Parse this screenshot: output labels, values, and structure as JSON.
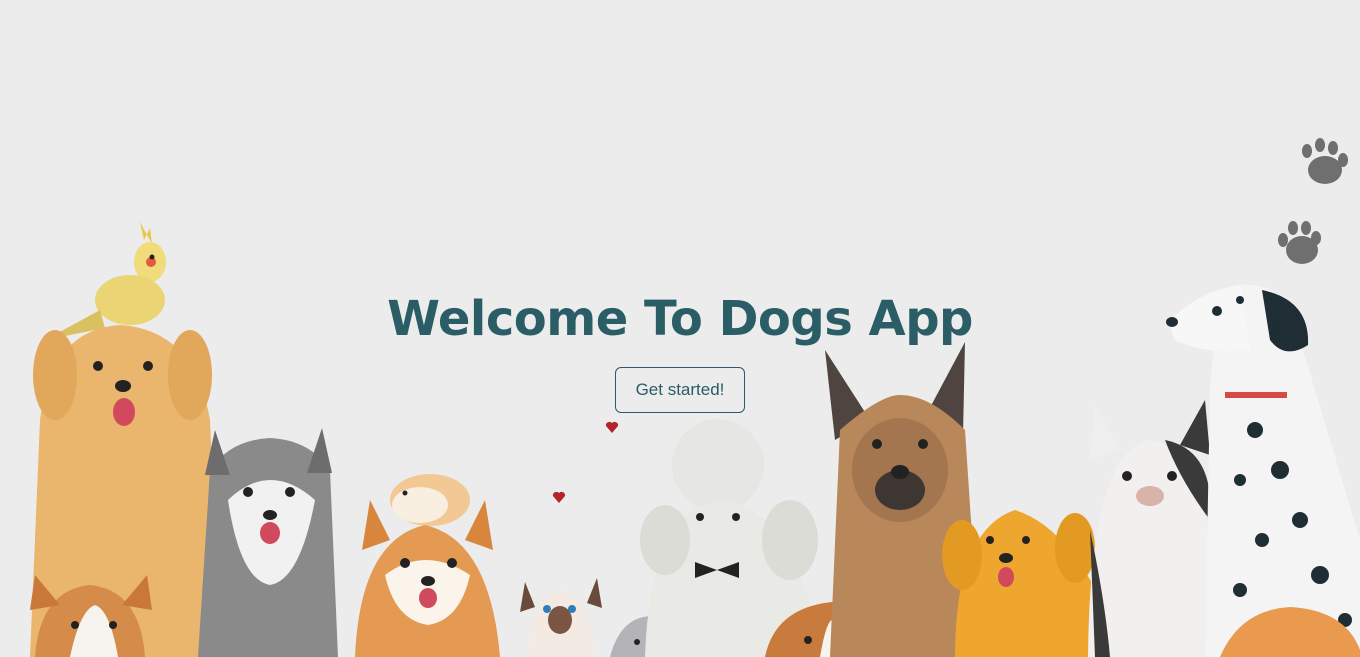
{
  "hero": {
    "title": "Welcome To Dogs App",
    "cta_label": "Get started!"
  },
  "colors": {
    "background": "#ececec",
    "accent": "#2a5d66"
  },
  "illustration": {
    "description_icons": [
      "paw-print-icon",
      "heart-icon"
    ]
  }
}
